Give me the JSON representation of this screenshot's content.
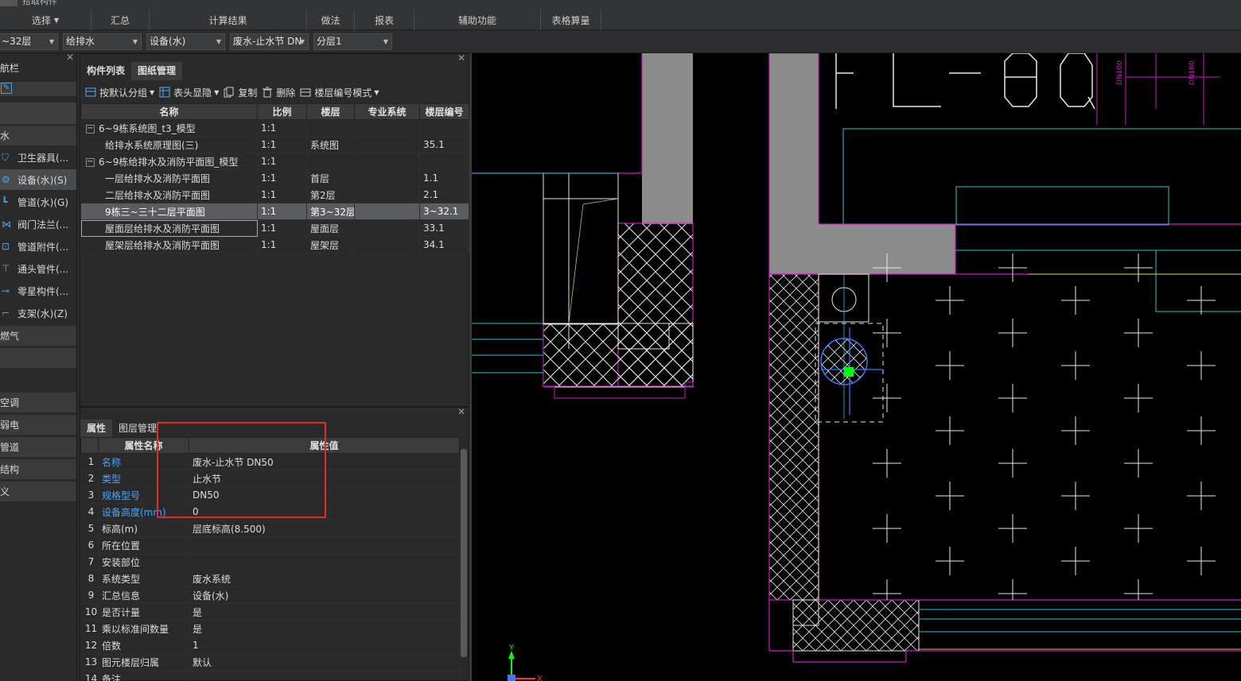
{
  "ribbon": {
    "top_label": "拾取构件",
    "groups": [
      {
        "label": "选择",
        "has_caret": true
      },
      {
        "label": "汇总",
        "has_caret": false
      },
      {
        "label": "计算结果",
        "has_caret": false
      },
      {
        "label": "做法",
        "has_caret": false
      },
      {
        "label": "报表",
        "has_caret": false
      },
      {
        "label": "辅助功能",
        "has_caret": false
      },
      {
        "label": "表格算量",
        "has_caret": false
      }
    ]
  },
  "dropdowns": {
    "floor": "~32层",
    "discipline": "给排水",
    "type": "设备(水)",
    "component": "废水-止水节 DN",
    "sublayer": "分层1"
  },
  "leftnav": {
    "title": "航栏",
    "items": [
      {
        "label": "卫生器具(...",
        "icon": "sanitary-icon",
        "selected": false
      },
      {
        "label": "设备(水)(S)",
        "icon": "equipment-icon",
        "selected": true
      },
      {
        "label": "管道(水)(G)",
        "icon": "pipe-icon",
        "selected": false
      },
      {
        "label": "阀门法兰(...",
        "icon": "valve-icon",
        "selected": false
      },
      {
        "label": "管道附件(...",
        "icon": "pipe-fitting-icon",
        "selected": false
      },
      {
        "label": "通头管件(...",
        "icon": "tee-icon",
        "selected": false
      },
      {
        "label": "零星构件(...",
        "icon": "misc-icon",
        "selected": false
      },
      {
        "label": "支架(水)(Z)",
        "icon": "bracket-icon",
        "selected": false
      }
    ],
    "categories_top": [
      "水"
    ],
    "categories": [
      "燃气",
      "空调",
      "弱电",
      "管道",
      "结构",
      "义"
    ]
  },
  "top_panel": {
    "tabs": [
      "构件列表",
      "图纸管理"
    ],
    "active_tab": 1,
    "toolbar": [
      {
        "label": "按默认分组",
        "icon": "group-icon",
        "caret": true
      },
      {
        "label": "表头显隐",
        "icon": "table-header-icon",
        "caret": true
      },
      {
        "label": "复制",
        "icon": "copy-icon",
        "caret": false
      },
      {
        "label": "删除",
        "icon": "delete-icon",
        "caret": false
      },
      {
        "label": "楼层编号模式",
        "icon": "floor-number-icon",
        "caret": true
      }
    ],
    "columns": [
      "名称",
      "比例",
      "楼层",
      "专业系统",
      "楼层编号"
    ],
    "rows": [
      {
        "name": "6~9栋系统图_t3_模型",
        "scale": "1:1",
        "floor": "",
        "system": "",
        "code": "",
        "group": true
      },
      {
        "name": "给排水系统原理图(三)",
        "scale": "1:1",
        "floor": "系统图",
        "system": "",
        "code": "35.1",
        "group": false
      },
      {
        "name": "6~9栋给排水及消防平面图_模型",
        "scale": "1:1",
        "floor": "",
        "system": "",
        "code": "",
        "group": true
      },
      {
        "name": "一层给排水及消防平面图",
        "scale": "1:1",
        "floor": "首层",
        "system": "",
        "code": "1.1",
        "group": false
      },
      {
        "name": "二层给排水及消防平面图",
        "scale": "1:1",
        "floor": "第2层",
        "system": "",
        "code": "2.1",
        "group": false
      },
      {
        "name": "9栋三~三十二层平面图",
        "scale": "1:1",
        "floor": "第3~32层",
        "system": "",
        "code": "3~32.1",
        "group": false,
        "selected": true
      },
      {
        "name": "屋面层给排水及消防平面图",
        "scale": "1:1",
        "floor": "屋面层",
        "system": "",
        "code": "33.1",
        "group": false,
        "focus": true
      },
      {
        "name": "屋架层给排水及消防平面图",
        "scale": "1:1",
        "floor": "屋架层",
        "system": "",
        "code": "34.1",
        "group": false
      }
    ]
  },
  "bottom_panel": {
    "tabs": [
      "属性",
      "图层管理"
    ],
    "columns": [
      "属性名称",
      "属性值"
    ],
    "rows": [
      {
        "num": "1",
        "name": "名称",
        "value": "废水-止水节 DN50",
        "blue": true
      },
      {
        "num": "2",
        "name": "类型",
        "value": "止水节",
        "blue": true
      },
      {
        "num": "3",
        "name": "规格型号",
        "value": "DN50",
        "blue": true
      },
      {
        "num": "4",
        "name": "设备高度(mm)",
        "value": "0",
        "blue": true
      },
      {
        "num": "5",
        "name": "标高(m)",
        "value": "层底标高(8.500)",
        "blue": false
      },
      {
        "num": "6",
        "name": "所在位置",
        "value": "",
        "blue": false
      },
      {
        "num": "7",
        "name": "安装部位",
        "value": "",
        "blue": false
      },
      {
        "num": "8",
        "name": "系统类型",
        "value": "废水系统",
        "blue": false
      },
      {
        "num": "9",
        "name": "汇总信息",
        "value": "设备(水)",
        "blue": false
      },
      {
        "num": "10",
        "name": "是否计量",
        "value": "是",
        "blue": false
      },
      {
        "num": "11",
        "name": "乘以标准间数量",
        "value": "是",
        "blue": false
      },
      {
        "num": "12",
        "name": "倍数",
        "value": "1",
        "blue": false
      },
      {
        "num": "13",
        "name": "图元楼层归属",
        "value": "默认",
        "blue": false
      },
      {
        "num": "14",
        "name": "备注",
        "value": "",
        "blue": false
      }
    ]
  },
  "canvas": {
    "labels": [
      "DN100",
      "DN100"
    ],
    "axis_labels": {
      "y": "Y",
      "x": "X"
    },
    "colors": {
      "wall_fill": "#8c8c8c",
      "magenta": "#c81ec8",
      "cyan": "#27c3d6",
      "yellow": "#c8c832",
      "white": "#e8e8e8",
      "green": "#00ff00",
      "blue": "#3c78ff"
    }
  }
}
